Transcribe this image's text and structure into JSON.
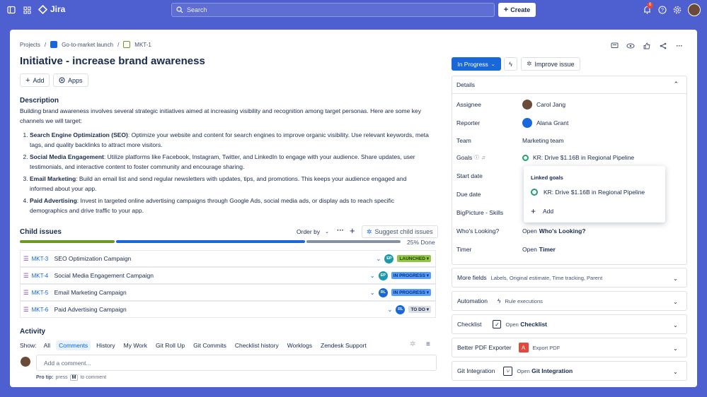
{
  "topbar": {
    "app_name": "Jira",
    "search_placeholder": "Search",
    "create_label": "Create",
    "notification_count": "6"
  },
  "breadcrumbs": [
    "Projects",
    "Go-to-market launch",
    "MKT-1"
  ],
  "issue": {
    "title": "Initiative - increase brand awareness",
    "add_label": "Add",
    "apps_label": "Apps"
  },
  "description": {
    "heading": "Description",
    "intro": "Building brand awareness involves several strategic initiatives aimed at increasing visibility and recognition among target personas. Here are some key channels we will target:",
    "items": [
      {
        "bold": "Search Engine Optimization (SEO)",
        "text": ": Optimize your website and content for search engines to improve organic visibility. Use relevant keywords, meta tags, and quality backlinks to attract more visitors."
      },
      {
        "bold": "Social Media Engagement",
        "text": ": Utilize platforms like Facebook, Instagram, Twitter, and LinkedIn to engage with your audience. Share updates, user testimonials, and interactive content to foster community and encourage sharing."
      },
      {
        "bold": "Email Marketing",
        "text": ": Build an email list and send regular newsletters with updates, tips, and promotions. This keeps your audience engaged and informed about your app."
      },
      {
        "bold": "Paid Advertising",
        "text": ": Invest in targeted online advertising campaigns through Google Ads, social media ads, or display ads to reach specific demographics and drive traffic to your app."
      }
    ]
  },
  "child_issues": {
    "heading": "Child issues",
    "order_by": "Order by",
    "suggest": "Suggest child issues",
    "done_text": "25% Done",
    "progress": {
      "done": 0.25,
      "in_progress": 0.5,
      "todo": 0.25
    },
    "rows": [
      {
        "key": "MKT-3",
        "summary": "SEO Optimization Campaign",
        "avatar": "EP",
        "avatar_color": "#1d9aaa",
        "status": "LAUNCHED",
        "status_bg": "#94c748",
        "status_fg": "#1f3b00"
      },
      {
        "key": "MKT-4",
        "summary": "Social Media Engagement Campaign",
        "avatar": "EP",
        "avatar_color": "#1d9aaa",
        "status": "IN PROGRESS",
        "status_bg": "#579dff",
        "status_fg": "#09326c"
      },
      {
        "key": "MKT-5",
        "summary": "Email Marketing Campaign",
        "avatar": "RL",
        "avatar_color": "#1868db",
        "status": "IN PROGRESS",
        "status_bg": "#579dff",
        "status_fg": "#09326c"
      },
      {
        "key": "MKT-6",
        "summary": "Paid Advertising Campaign",
        "avatar": "RL",
        "avatar_color": "#1868db",
        "status": "TO DO",
        "status_bg": "#dcdfe4",
        "status_fg": "#172b4d"
      }
    ]
  },
  "activity": {
    "heading": "Activity",
    "show_label": "Show:",
    "tabs": [
      "All",
      "Comments",
      "History",
      "My Work",
      "Git Roll Up",
      "Git Commits",
      "Checklist history",
      "Worklogs",
      "Zendesk Support"
    ],
    "comment_placeholder": "Add a comment...",
    "pro_tip_prefix": "Pro tip:",
    "pro_tip_press": "press",
    "pro_tip_key": "M",
    "pro_tip_suffix": "to comment"
  },
  "sidebar": {
    "status": "In Progress",
    "improve": "Improve issue",
    "details_heading": "Details",
    "assignee_label": "Assignee",
    "assignee": "Carol Jang",
    "reporter_label": "Reporter",
    "reporter": "Alana Grant",
    "team_label": "Team",
    "team": "Marketing team",
    "goals_label": "Goals",
    "goal": "KR: Drive $1.16B in Regional Pipeline",
    "start_label": "Start date",
    "due_label": "Due date",
    "bigpicture_label": "BigPicture - Skills",
    "whos_label": "Who's Looking?",
    "whos_open": "Open",
    "whos_value": "Who's Looking?",
    "timer_label": "Timer",
    "timer_open": "Open",
    "timer_value": "Timer",
    "popup_heading": "Linked goals",
    "popup_goal": "KR: Drive $1.16B in Regional Pipeline",
    "popup_add": "Add",
    "more_fields": "More fields",
    "more_fields_sub": "Labels, Original estimate, Time tracking, Parent",
    "automation": "Automation",
    "automation_sub": "Rule executions",
    "checklist": "Checklist",
    "checklist_open": "Open",
    "checklist_value": "Checklist",
    "pdf": "Better PDF Exporter",
    "pdf_sub": "Export PDF",
    "git": "Git Integration",
    "git_open": "Open",
    "git_value": "Git Integration"
  }
}
